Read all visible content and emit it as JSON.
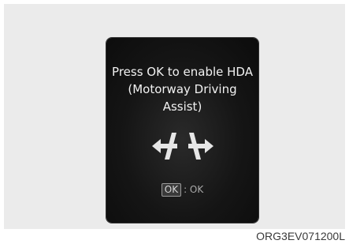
{
  "dialog": {
    "message": "Press OK to enable HDA\n(Motorway Driving\nAssist)",
    "icon": "hda-lane-change-arrows-icon",
    "ok_key_label": "OK",
    "ok_action": ": OK"
  },
  "figure_code": "ORG3EV071200L",
  "colors": {
    "panel_background": "#151515",
    "text": "#f2f2f2",
    "muted_text": "#a9a9a9",
    "figure_background": "#ebebeb"
  }
}
